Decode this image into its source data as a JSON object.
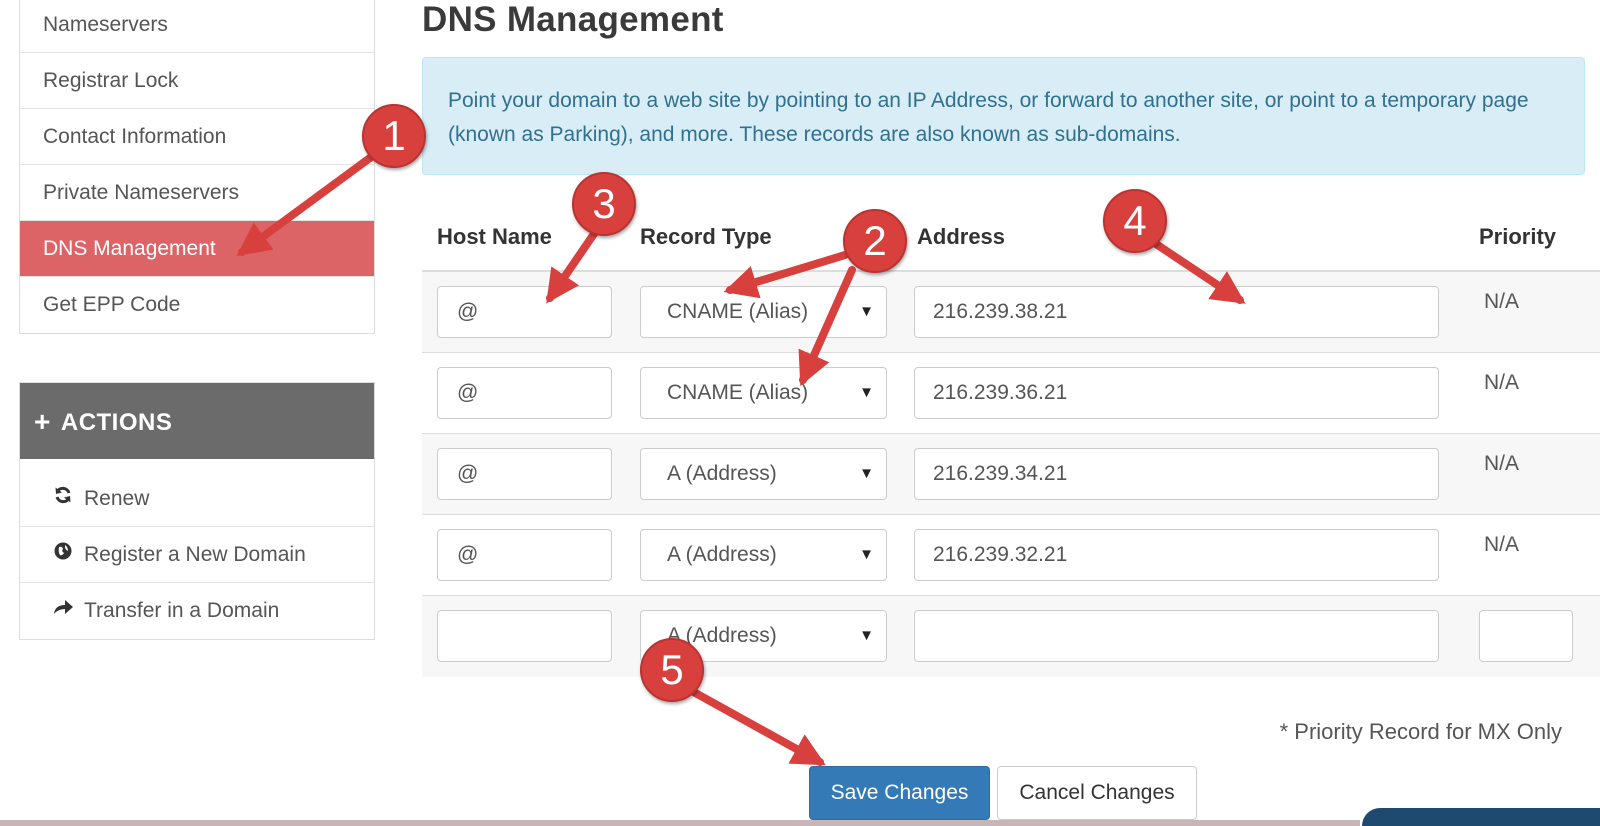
{
  "sidebar": {
    "items": [
      {
        "label": "Nameservers"
      },
      {
        "label": "Registrar Lock"
      },
      {
        "label": "Contact Information"
      },
      {
        "label": "Private Nameservers"
      },
      {
        "label": "DNS Management",
        "active": true
      },
      {
        "label": "Get EPP Code"
      }
    ]
  },
  "actions": {
    "title": "ACTIONS",
    "items": [
      {
        "label": "Renew",
        "icon": "refresh-icon"
      },
      {
        "label": "Register a New Domain",
        "icon": "globe-icon"
      },
      {
        "label": "Transfer in a Domain",
        "icon": "share-arrow-icon"
      }
    ]
  },
  "page": {
    "title": "DNS Management",
    "info": "Point your domain to a web site by pointing to an IP Address, or forward to another site, or point to a temporary page (known as Parking), and more. These records are also known as sub-domains."
  },
  "table": {
    "headers": {
      "host": "Host Name",
      "type": "Record Type",
      "address": "Address",
      "priority": "Priority"
    },
    "rows": [
      {
        "host": "@",
        "type": "CNAME (Alias)",
        "address": "216.239.38.21",
        "priority": "N/A"
      },
      {
        "host": "@",
        "type": "CNAME (Alias)",
        "address": "216.239.36.21",
        "priority": "N/A"
      },
      {
        "host": "@",
        "type": "A (Address)",
        "address": "216.239.34.21",
        "priority": "N/A"
      },
      {
        "host": "@",
        "type": "A (Address)",
        "address": "216.239.32.21",
        "priority": "N/A"
      },
      {
        "host": "",
        "type": "A (Address)",
        "address": "",
        "priority": ""
      }
    ],
    "note": "* Priority Record for MX Only"
  },
  "buttons": {
    "save": "Save Changes",
    "cancel": "Cancel Changes"
  },
  "annotations": {
    "color": "#d8403e",
    "badges": [
      "1",
      "2",
      "3",
      "4",
      "5"
    ]
  }
}
